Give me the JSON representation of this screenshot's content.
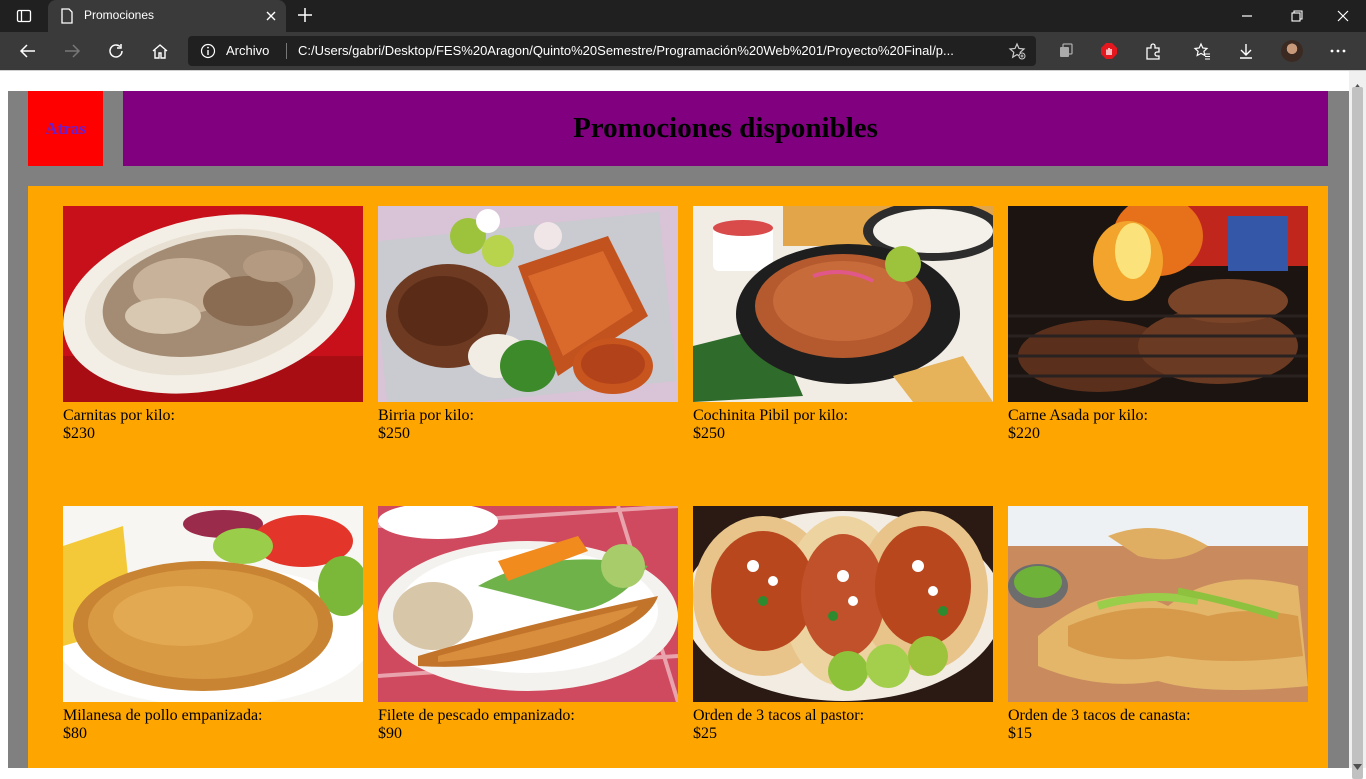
{
  "browser": {
    "tab_title": "Promociones",
    "address_label": "Archivo",
    "url": "C:/Users/gabri/Desktop/FES%20Aragon/Quinto%20Semestre/Programación%20Web%201/Proyecto%20Final/p..."
  },
  "page": {
    "back_label": "Atras",
    "title": "Promociones disponibles"
  },
  "promotions": [
    {
      "name": "Carnitas por kilo:",
      "price": "$230",
      "image": "carnitas-plate"
    },
    {
      "name": "Birria por kilo:",
      "price": "$250",
      "image": "birria-tacos"
    },
    {
      "name": "Cochinita Pibil por kilo:",
      "price": "$250",
      "image": "cochinita-plate"
    },
    {
      "name": "Carne Asada por kilo:",
      "price": "$220",
      "image": "grill-meat"
    },
    {
      "name": "Milanesa de pollo empanizada:",
      "price": "$80",
      "image": "milanesa-plate"
    },
    {
      "name": "Filete de pescado empanizado:",
      "price": "$90",
      "image": "fish-fillet-plate"
    },
    {
      "name": "Orden de 3 tacos al pastor:",
      "price": "$25",
      "image": "pastor-tacos"
    },
    {
      "name": "Orden de 3 tacos de canasta:",
      "price": "$15",
      "image": "canasta-tacos"
    }
  ],
  "colors": {
    "page_bg": "#808080",
    "header_bg": "#800080",
    "back_bg": "#ff0000",
    "panel_bg": "#ffa500"
  }
}
